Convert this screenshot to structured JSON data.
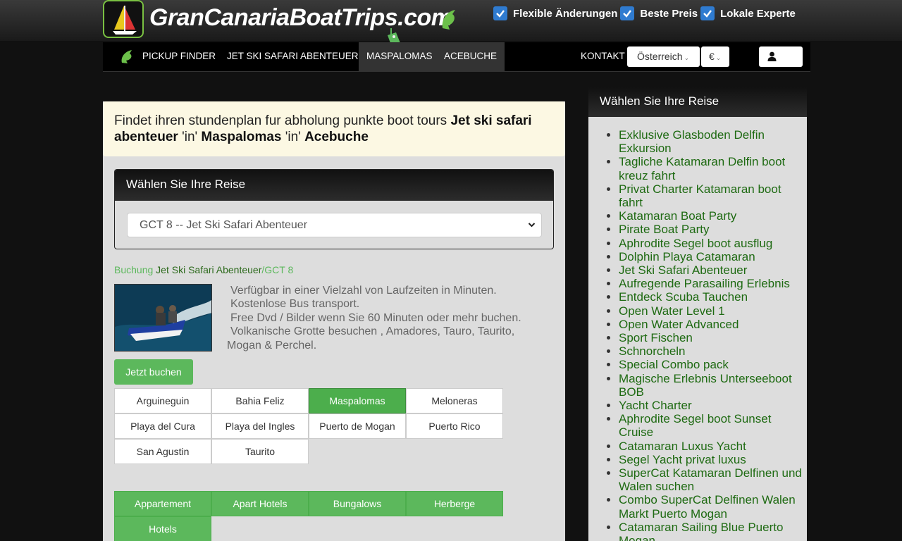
{
  "header": {
    "logo_text": "GranCanariaBoatTrips.com",
    "features": [
      "Flexible Änderungen",
      "Beste Preis",
      "Lokale Experte"
    ]
  },
  "nav": {
    "items": [
      "PICKUP FINDER",
      "JET SKI SAFARI ABENTEUER",
      "MASPALOMAS",
      "ACEBUCHE"
    ],
    "contact": "KONTAKT",
    "country": "Österreich",
    "currency": "€"
  },
  "headline": {
    "prefix": "Findet ihren stundenplan fur abholung punkte boot tours ",
    "tour": "Jet ski safari abenteuer",
    "in1": " 'in' ",
    "place": "Maspalomas",
    "in2": " 'in' ",
    "pickup": "Acebuche"
  },
  "select_panel": {
    "title": "Wählen Sie Ihre Reise",
    "selected": "GCT 8 -- Jet Ski Safari Abenteuer"
  },
  "breadcrumb": {
    "booking": "Buchung",
    "tour": "Jet Ski Safari Abenteuer",
    "code": "/GCT 8"
  },
  "description": [
    "Verfügbar in einer Vielzahl von Laufzeiten in Minuten.",
    "Kostenlose Bus transport.",
    "Free Dvd / Bilder wenn Sie 60 Minuten oder mehr buchen.",
    "Volkanische Grotte besuchen , Amadores, Tauro, Taurito,",
    "Mogan & Perchel."
  ],
  "book_button": "Jetzt buchen",
  "locations": [
    "Arguineguin",
    "Bahia Feliz",
    "Maspalomas",
    "Meloneras",
    "Playa del Cura",
    "Playa del Ingles",
    "Puerto de Mogan",
    "Puerto Rico",
    "San Agustin",
    "Taurito"
  ],
  "active_location": "Maspalomas",
  "accommodation": [
    "Appartement",
    "Apart Hotels",
    "Bungalows",
    "Herberge",
    "Hotels"
  ],
  "sidebar": {
    "title": "Wählen Sie Ihre Reise",
    "items": [
      "Exklusive Glasboden Delfin Exkursion",
      "Tagliche Katamaran Delfin boot kreuz fahrt",
      "Privat Charter Katamaran boot fahrt",
      "Katamaran Boat Party",
      "Pirate Boat Party",
      "Aphrodite Segel boot ausflug",
      "Dolphin Playa Catamaran",
      "Jet Ski Safari Abenteuer",
      "Aufregende Parasailing Erlebnis",
      "Entdeck Scuba Tauchen",
      "Open Water Level 1",
      "Open Water Advanced",
      "Sport Fischen",
      "Schnorcheln",
      "Special Combo pack",
      "Magische Erlebnis Unterseeboot BOB",
      "Yacht Charter",
      "Aphrodite Segel boot Sunset Cruise",
      "Catamaran Luxus Yacht",
      "Segel Yacht privat luxus",
      "SuperCat Katamaran Delfinen und Walen suchen",
      "Combo SuperCat Delfinen Walen Markt Puerto Mogan",
      "Catamaran Sailing Blue Puerto Mogan"
    ]
  },
  "colors": {
    "accent_green": "#5cb85c",
    "link_green": "#1e6a12",
    "check_blue": "#2f7bd0"
  }
}
